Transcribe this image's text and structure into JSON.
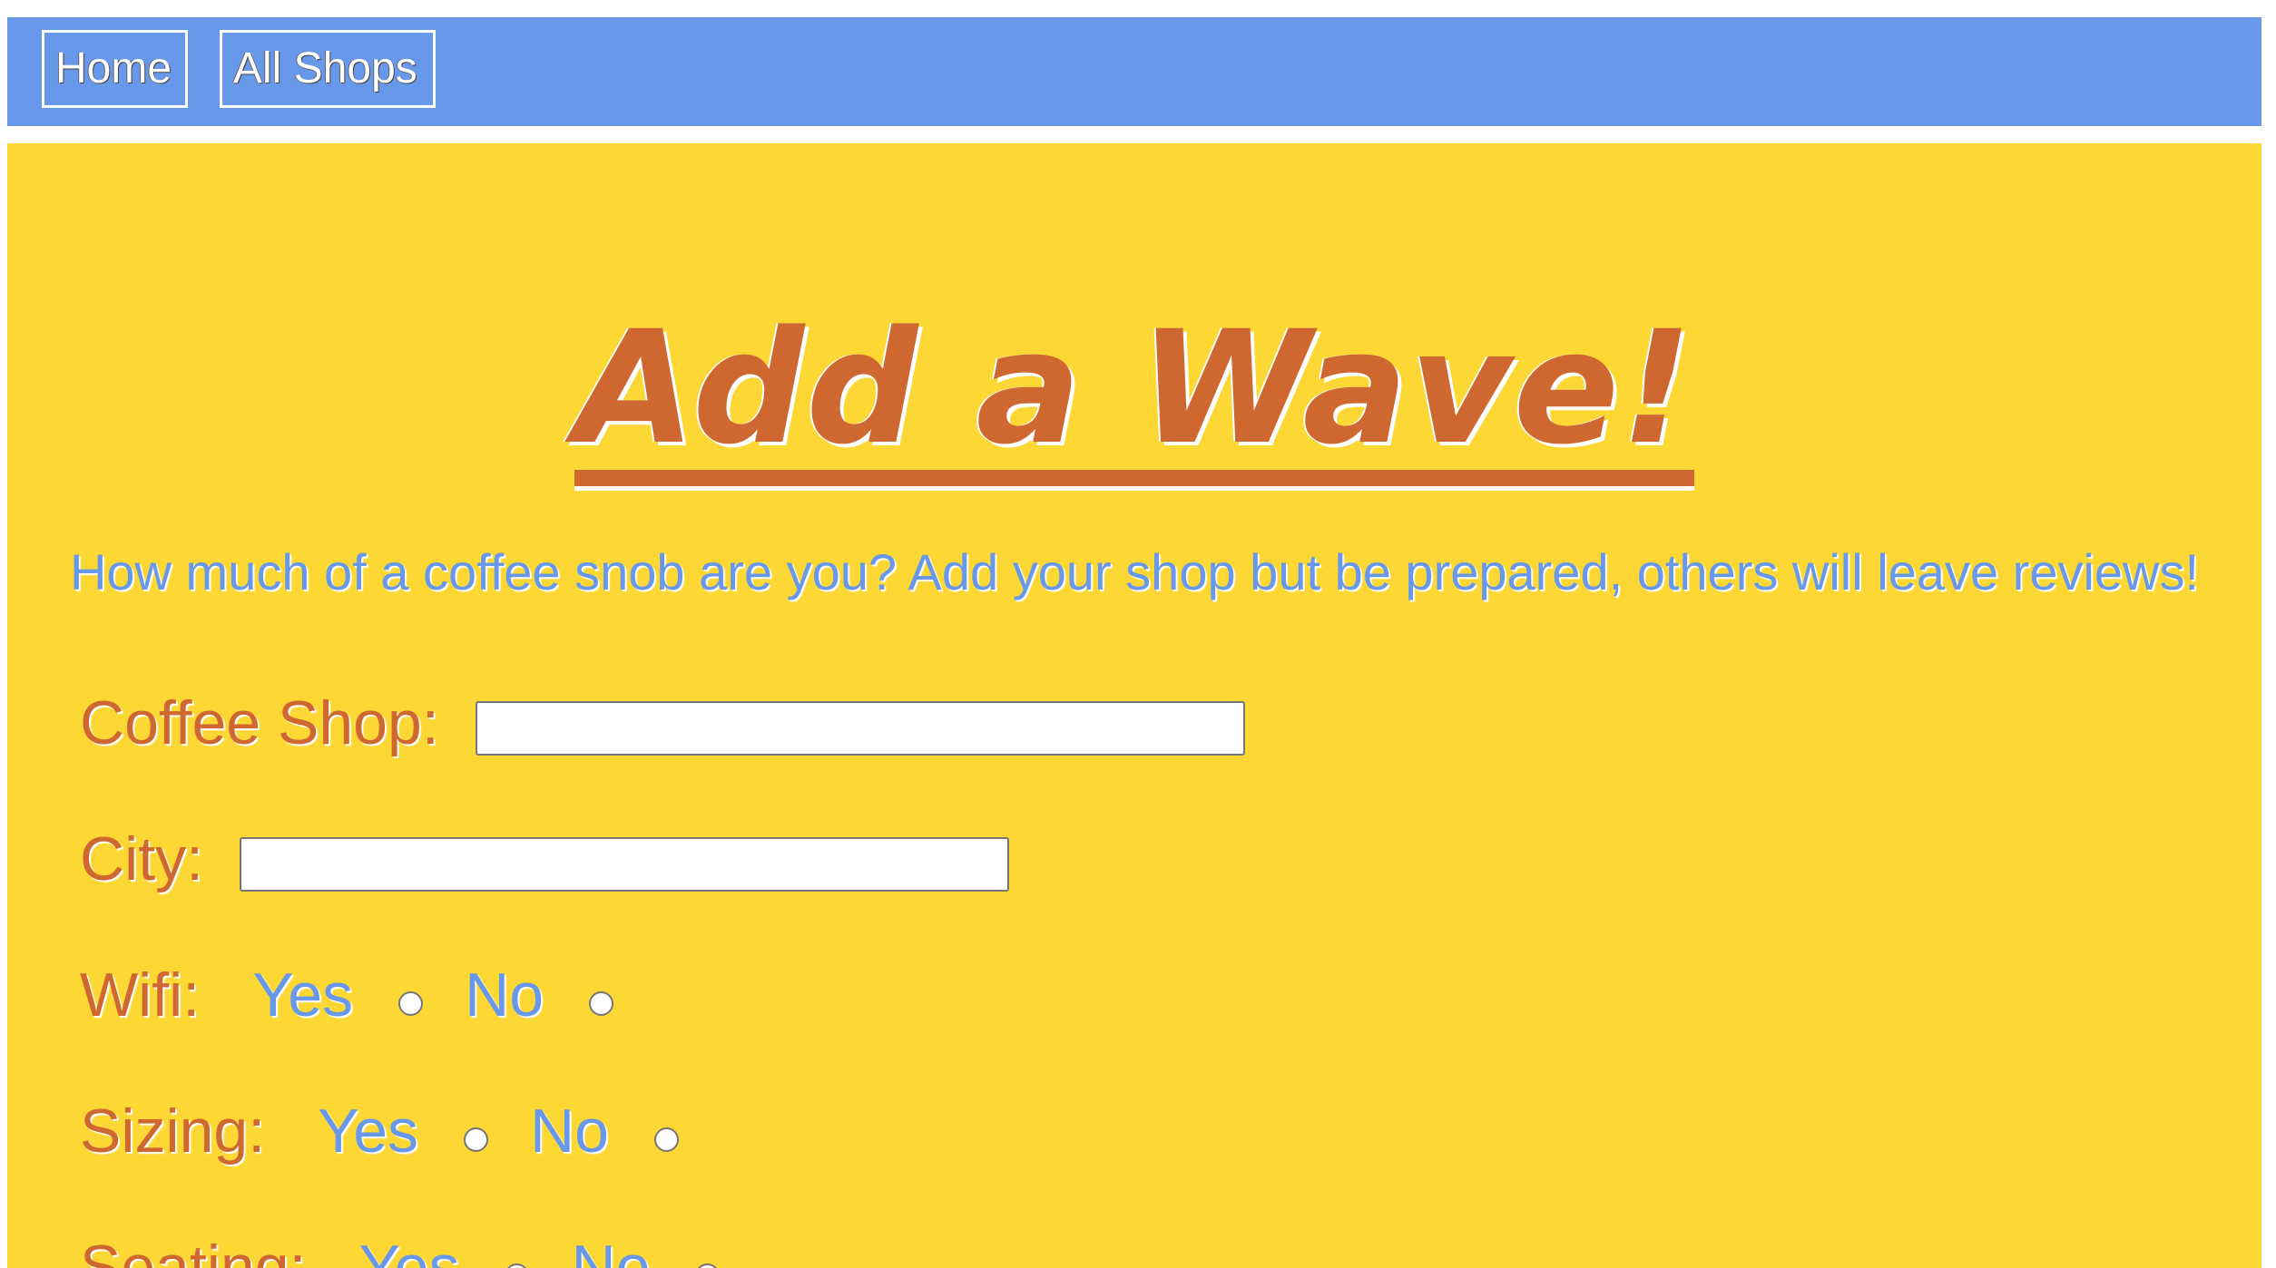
{
  "nav": {
    "items": [
      {
        "label": "Home"
      },
      {
        "label": "All Shops"
      }
    ]
  },
  "main": {
    "title": "Add a Wave!",
    "subtitle": "How much of a coffee snob are you? Add your shop but be prepared, others will leave reviews!",
    "fields": {
      "coffee_shop": {
        "label": "Coffee Shop:",
        "value": "",
        "placeholder": ""
      },
      "city": {
        "label": "City:",
        "value": "",
        "placeholder": ""
      }
    },
    "options": {
      "wifi": {
        "label": "Wifi:",
        "yes": "Yes",
        "no": "No"
      },
      "sizing": {
        "label": "Sizing:",
        "yes": "Yes",
        "no": "No"
      },
      "seating": {
        "label": "Seating:",
        "yes": "Yes",
        "no": "No"
      }
    }
  },
  "colors": {
    "nav_bg": "#6898ea",
    "main_bg": "#fdd835",
    "title": "#cf6830",
    "label": "#cf6830",
    "option": "#6898ea"
  }
}
